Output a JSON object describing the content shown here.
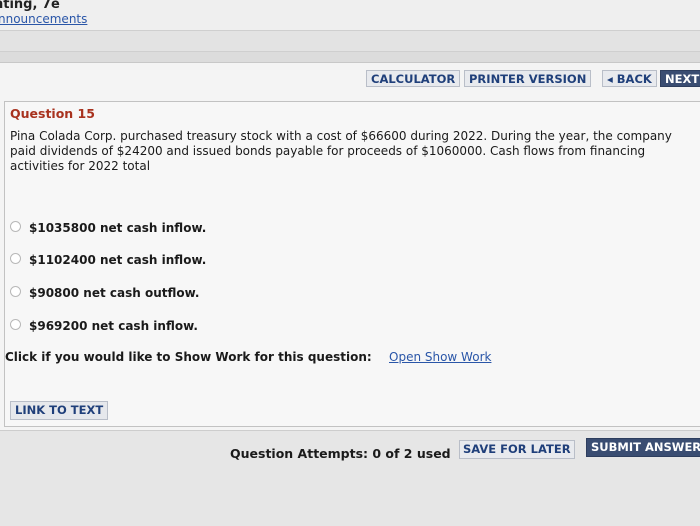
{
  "header": {
    "course_title": "nting, 7e",
    "announcements_link": "nnouncements"
  },
  "toolbar": {
    "calculator": "CALCULATOR",
    "printer_version": "PRINTER VERSION",
    "back": "◂ BACK",
    "next": "NEXT"
  },
  "question": {
    "label": "Question 15",
    "text": "Pina Colada Corp. purchased treasury stock with a cost of $66600 during 2022. During the year, the company paid dividends of $24200 and issued bonds payable for proceeds of $1060000. Cash flows from financing activities for 2022 total",
    "options": [
      "$1035800 net cash inflow.",
      "$1102400 net cash inflow.",
      "$90800 net cash outflow.",
      "$969200 net cash inflow."
    ],
    "show_work_prompt": "Click if you would like to Show Work for this question:",
    "show_work_link": "Open Show Work"
  },
  "link_to_text": "LINK TO TEXT",
  "footer": {
    "attempts": "Question Attempts: 0 of 2 used",
    "save_for_later": "SAVE FOR LATER",
    "submit": "SUBMIT ANSWER"
  }
}
